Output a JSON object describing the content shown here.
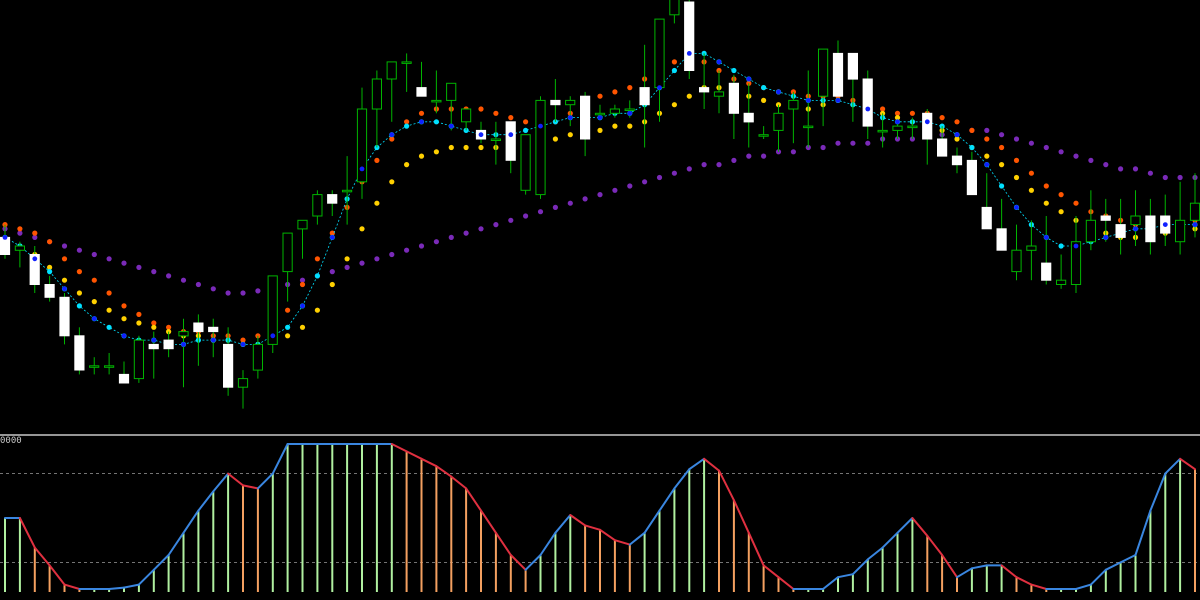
{
  "colors": {
    "background": "#000000",
    "bull_body": "#000000",
    "bull_outline": "#00b400",
    "bear_body": "#ffffff",
    "wick": "#00b400",
    "divider": "#c8c8c8",
    "level_line": "#9a9a9a",
    "osc_up": "#3a86e0",
    "osc_down": "#e03040",
    "hist_up": "#b0f0a0",
    "hist_down": "#f4a060"
  },
  "indicator_panel": {
    "level_label": "0000"
  },
  "chart_data": [
    {
      "type": "candlestick",
      "name": "",
      "ylim": [
        0,
        100
      ],
      "x": [
        0,
        1,
        2,
        3,
        4,
        5,
        6,
        7,
        8,
        9,
        10,
        11,
        12,
        13,
        14,
        15,
        16,
        17,
        18,
        19,
        20,
        21,
        22,
        23,
        24,
        25,
        26,
        27,
        28,
        29,
        30,
        31,
        32,
        33,
        34,
        35,
        36,
        37,
        38,
        39,
        40,
        41,
        42,
        43,
        44,
        45,
        46,
        47,
        48,
        49,
        50,
        51,
        52,
        53,
        54,
        55,
        56,
        57,
        58,
        59,
        60,
        61,
        62,
        63,
        64,
        65,
        66,
        67,
        68,
        69,
        70,
        71,
        72,
        73,
        74,
        75,
        76,
        77,
        78,
        79,
        80
      ],
      "ohlc": [
        [
          45,
          48,
          40,
          41
        ],
        [
          42,
          44,
          38,
          43
        ],
        [
          41,
          43,
          32,
          34
        ],
        [
          34,
          36,
          30,
          31
        ],
        [
          31,
          32,
          20,
          22
        ],
        [
          22,
          24,
          13,
          14
        ],
        [
          15,
          17,
          13,
          15
        ],
        [
          15,
          18,
          13,
          15
        ],
        [
          13,
          16,
          11,
          11
        ],
        [
          12,
          22,
          11,
          21
        ],
        [
          20,
          23,
          12,
          19
        ],
        [
          21,
          23,
          17,
          19
        ],
        [
          22,
          26,
          10,
          23
        ],
        [
          25,
          27,
          15,
          23
        ],
        [
          24,
          26,
          17,
          23
        ],
        [
          20,
          24,
          8,
          10
        ],
        [
          10,
          14,
          5,
          12
        ],
        [
          14,
          22,
          12,
          20
        ],
        [
          20,
          36,
          18,
          36
        ],
        [
          37,
          46,
          30,
          46
        ],
        [
          47,
          49,
          40,
          49
        ],
        [
          50,
          56,
          48,
          55
        ],
        [
          55,
          56,
          50,
          53
        ],
        [
          56,
          64,
          48,
          56
        ],
        [
          58,
          80,
          54,
          75
        ],
        [
          75,
          84,
          66,
          82
        ],
        [
          82,
          85,
          72,
          86
        ],
        [
          86,
          88,
          79,
          86
        ],
        [
          80,
          86,
          78,
          78
        ],
        [
          77,
          84,
          74,
          77
        ],
        [
          77,
          81,
          70,
          81
        ],
        [
          72,
          75,
          70,
          75
        ],
        [
          70,
          72,
          67,
          68
        ],
        [
          68,
          72,
          62,
          68
        ],
        [
          72,
          71,
          60,
          63
        ],
        [
          56,
          69,
          55,
          69
        ],
        [
          55,
          78,
          54,
          77
        ],
        [
          77,
          82,
          72,
          76
        ],
        [
          76,
          78,
          71,
          77
        ],
        [
          78,
          79,
          64,
          68
        ],
        [
          74,
          76,
          73,
          74
        ],
        [
          74,
          76,
          73,
          75
        ],
        [
          75,
          77,
          73,
          75
        ],
        [
          80,
          90,
          66,
          76
        ],
        [
          80,
          96,
          72,
          96
        ],
        [
          97,
          101,
          95,
          101
        ],
        [
          100,
          102,
          82,
          84
        ],
        [
          80,
          88,
          75,
          79
        ],
        [
          78,
          84,
          74,
          79
        ],
        [
          81,
          83,
          68,
          74
        ],
        [
          74,
          81,
          66,
          72
        ],
        [
          69,
          71,
          68,
          69
        ],
        [
          70,
          76,
          65,
          74
        ],
        [
          75,
          79,
          67,
          77
        ],
        [
          71,
          84,
          66,
          71
        ],
        [
          78,
          89,
          71,
          89
        ],
        [
          88,
          91,
          80,
          78
        ],
        [
          88,
          86,
          72,
          82
        ],
        [
          82,
          84,
          68,
          71
        ],
        [
          70,
          74,
          66,
          70
        ],
        [
          70,
          72,
          68,
          71
        ],
        [
          71,
          73,
          68,
          71
        ],
        [
          74,
          75,
          62,
          68
        ],
        [
          68,
          71,
          65,
          64
        ],
        [
          64,
          66,
          60,
          62
        ],
        [
          63,
          65,
          55,
          55
        ],
        [
          52,
          60,
          50,
          47
        ],
        [
          47,
          54,
          44,
          42
        ],
        [
          37,
          48,
          35,
          42
        ],
        [
          42,
          49,
          35,
          43
        ],
        [
          39,
          50,
          34,
          35
        ],
        [
          34,
          41,
          33,
          35
        ],
        [
          34,
          50,
          32,
          44
        ],
        [
          44,
          56,
          42,
          49
        ],
        [
          50,
          54,
          44,
          49
        ],
        [
          48,
          54,
          41,
          45
        ],
        [
          48,
          56,
          43,
          50
        ],
        [
          50,
          54,
          41,
          44
        ],
        [
          50,
          55,
          43,
          46
        ],
        [
          44,
          58,
          41,
          49
        ],
        [
          49,
          60,
          45,
          53
        ]
      ],
      "overlays": [
        {
          "name": "",
          "color": "#7a2ab8",
          "values": [
            47,
            46,
            45,
            44,
            43,
            42,
            41,
            40,
            39,
            38,
            37,
            36,
            35,
            34,
            33,
            32,
            32,
            32.5,
            33,
            34,
            35,
            36,
            37,
            38,
            39,
            40,
            41,
            42,
            43,
            44,
            45,
            46,
            47,
            48,
            49,
            50,
            51,
            52,
            53,
            54,
            55,
            56,
            57,
            58,
            59,
            60,
            61,
            62,
            62,
            63,
            64,
            64,
            65,
            65,
            66,
            66,
            67,
            67,
            67,
            68,
            68,
            68,
            69,
            69,
            69,
            70,
            70,
            69,
            68,
            67,
            66,
            65,
            64,
            63,
            62,
            61,
            61,
            60,
            59,
            59,
            59
          ]
        },
        {
          "name": "",
          "color": "#ff5500",
          "values": [
            48,
            47,
            46,
            44,
            40,
            37,
            35,
            32,
            29,
            27,
            25,
            24,
            23,
            23,
            22,
            22,
            21,
            22,
            24,
            28,
            34,
            40,
            46,
            52,
            58,
            63,
            68,
            72,
            74,
            75,
            75,
            75,
            75,
            74,
            73,
            72,
            71,
            72,
            74,
            76,
            78,
            79,
            80,
            82,
            84,
            86,
            88,
            86,
            84,
            82,
            81,
            80,
            79,
            79,
            78,
            78,
            78,
            77,
            76,
            75,
            74,
            74,
            74,
            73,
            72,
            70,
            68,
            66,
            63,
            60,
            57,
            55,
            53,
            51,
            50,
            49,
            48,
            48,
            48,
            48,
            49
          ]
        },
        {
          "name": "",
          "color": "#ffd000",
          "values": [
            44,
            43,
            41,
            38,
            35,
            32,
            30,
            28,
            26,
            25,
            24,
            23,
            22,
            22,
            21,
            21,
            20,
            20,
            21,
            22,
            24,
            28,
            34,
            40,
            47,
            53,
            58,
            62,
            64,
            65,
            66,
            66,
            66,
            66,
            66,
            67,
            68,
            68,
            69,
            70,
            70,
            71,
            71,
            72,
            74,
            76,
            78,
            80,
            80,
            79,
            78,
            77,
            76,
            76,
            75,
            76,
            77,
            76,
            75,
            74,
            73,
            72,
            71,
            70,
            68,
            66,
            64,
            62,
            59,
            56,
            53,
            51,
            49,
            47,
            46,
            45,
            45,
            45,
            46,
            46,
            47
          ]
        },
        {
          "name": "",
          "color": "#00e0ff",
          "values": [
            45,
            43,
            40,
            37,
            33,
            29,
            26,
            24,
            22,
            21,
            21,
            20,
            20,
            21,
            21,
            21,
            20,
            20,
            22,
            24,
            29,
            36,
            45,
            54,
            61,
            66,
            69,
            71,
            72,
            72,
            71,
            70,
            69,
            69,
            69,
            70,
            71,
            72,
            73,
            73,
            73,
            74,
            74,
            76,
            80,
            84,
            88,
            88,
            86,
            84,
            82,
            80,
            79,
            78,
            77,
            77,
            77,
            76,
            75,
            73,
            72,
            72,
            72,
            71,
            69,
            66,
            62,
            57,
            52,
            48,
            45,
            43,
            43,
            44,
            45,
            46,
            47,
            47,
            48,
            48,
            48
          ]
        }
      ]
    },
    {
      "type": "line",
      "name": "",
      "ylim": [
        0,
        100
      ],
      "levels": [
        80,
        20
      ],
      "x": [
        0,
        1,
        2,
        3,
        4,
        5,
        6,
        7,
        8,
        9,
        10,
        11,
        12,
        13,
        14,
        15,
        16,
        17,
        18,
        19,
        20,
        21,
        22,
        23,
        24,
        25,
        26,
        27,
        28,
        29,
        30,
        31,
        32,
        33,
        34,
        35,
        36,
        37,
        38,
        39,
        40,
        41,
        42,
        43,
        44,
        45,
        46,
        47,
        48,
        49,
        50,
        51,
        52,
        53,
        54,
        55,
        56,
        57,
        58,
        59,
        60,
        61,
        62,
        63,
        64,
        65,
        66,
        67,
        68,
        69,
        70,
        71,
        72,
        73,
        74,
        75,
        76,
        77,
        78,
        79,
        80
      ],
      "values": [
        50,
        50,
        30,
        18,
        5,
        2,
        2,
        2,
        3,
        5,
        15,
        25,
        40,
        55,
        68,
        80,
        72,
        70,
        80,
        100,
        100,
        100,
        100,
        100,
        100,
        100,
        100,
        95,
        90,
        85,
        78,
        70,
        55,
        40,
        25,
        15,
        25,
        40,
        52,
        45,
        42,
        35,
        32,
        40,
        55,
        70,
        83,
        90,
        82,
        62,
        40,
        18,
        10,
        2,
        2,
        2,
        10,
        12,
        22,
        30,
        40,
        50,
        38,
        25,
        10,
        16,
        18,
        18,
        10,
        5,
        2,
        2,
        2,
        5,
        15,
        20,
        25,
        55,
        80,
        90,
        83,
        90,
        95
      ],
      "histogram": [
        50,
        50,
        30,
        18,
        5,
        2,
        2,
        2,
        3,
        5,
        15,
        25,
        40,
        55,
        68,
        80,
        72,
        70,
        80,
        100,
        100,
        100,
        100,
        100,
        100,
        100,
        100,
        95,
        90,
        85,
        78,
        70,
        55,
        40,
        25,
        15,
        25,
        40,
        52,
        45,
        42,
        35,
        32,
        40,
        55,
        70,
        83,
        90,
        82,
        62,
        40,
        18,
        10,
        2,
        2,
        2,
        10,
        12,
        22,
        30,
        40,
        50,
        38,
        25,
        10,
        16,
        18,
        18,
        10,
        5,
        2,
        2,
        2,
        5,
        15,
        20,
        25,
        55,
        80,
        90,
        83,
        90,
        95
      ]
    }
  ]
}
